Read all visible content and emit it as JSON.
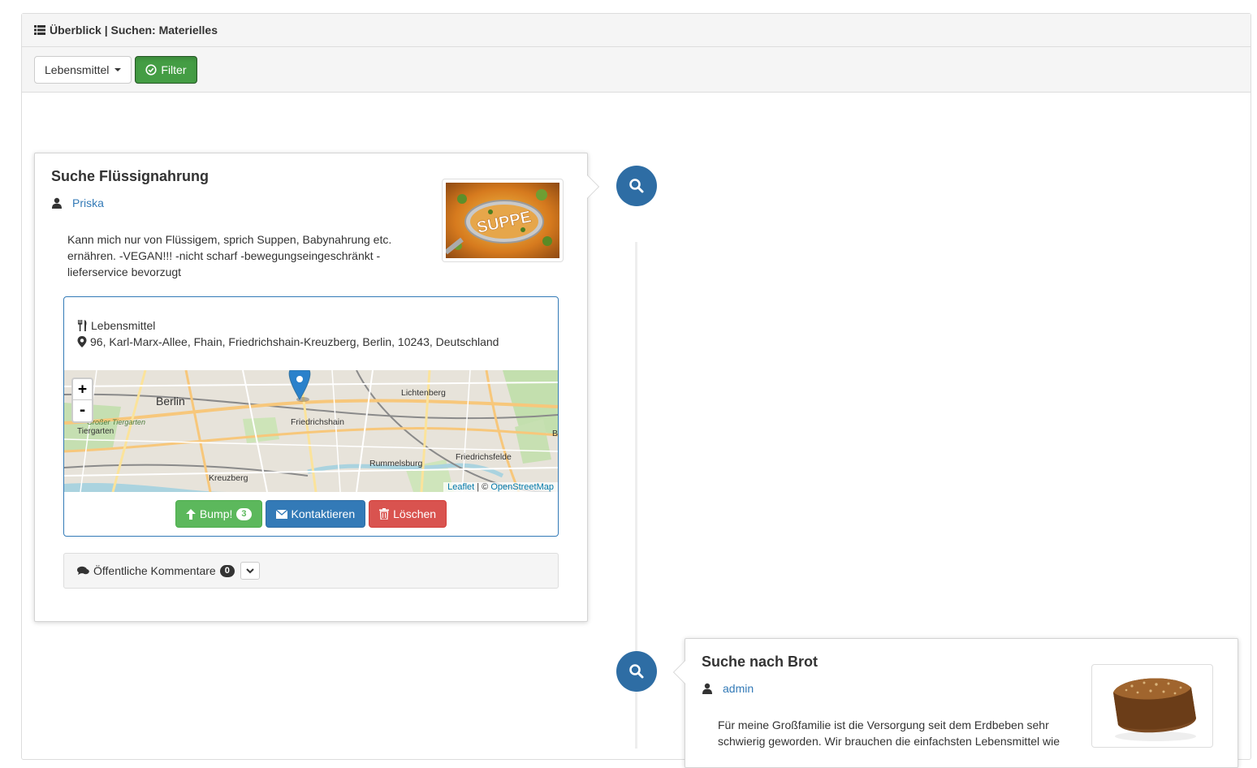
{
  "header": {
    "title": "Überblick | Suchen: Materielles",
    "icon": "list-icon"
  },
  "toolbar": {
    "category_label": "Lebensmittel",
    "filter_label": "Filter"
  },
  "colors": {
    "primary": "#337ab7",
    "success": "#5cb85c",
    "danger": "#d9534f",
    "filter_active": "#449d44",
    "timeline_badge": "#2e6da4"
  },
  "posts": [
    {
      "title": "Suche Flüssignahrung",
      "author": "Priska",
      "text": "Kann mich nur von Flüssigem, sprich Suppen, Babynahrung etc. ernähren. -VEGAN!!! -nicht scharf -bewegungseingeschränkt -lieferservice bevorzugt",
      "image_text": "SUPPE",
      "category": "Lebensmittel",
      "address": "96, Karl-Marx-Allee, Fhain, Friedrichshain-Kreuzberg, Berlin, 10243, Deutschland",
      "map": {
        "labels": [
          "Berlin",
          "Großer Tiergarten",
          "Tiergarten",
          "Friedrichshain",
          "Lichtenberg",
          "Rummelsburg",
          "Friedrichsfelde",
          "Kreuzberg",
          "B"
        ],
        "zoom_in": "+",
        "zoom_out": "-",
        "attribution_leaflet": "Leaflet",
        "attribution_sep": "| ©",
        "attribution_osm": "OpenStreetMap"
      },
      "bump_label": "Bump!",
      "bump_count": "3",
      "contact_label": "Kontaktieren",
      "delete_label": "Löschen",
      "comments_label": "Öffentliche Kommentare",
      "comments_count": "0"
    },
    {
      "title": "Suche nach Brot",
      "author": "admin",
      "text": "Für meine Großfamilie ist die Versorgung seit dem Erdbeben sehr schwierig geworden. Wir brauchen die einfachsten Lebensmittel wie"
    }
  ]
}
